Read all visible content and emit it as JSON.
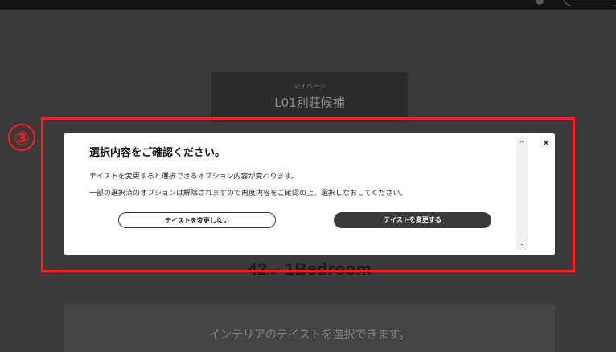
{
  "background": {
    "mypage_label": "マイページ",
    "plan_title": "L01別荘候補",
    "size_main": "42",
    "size_unit": "m²",
    "bedroom_label": "1Bedroom",
    "interior_prompt": "インテリアのテイストを選択できます。"
  },
  "annotation": {
    "step_number": "③",
    "color": "#ff1d1d"
  },
  "modal": {
    "title": "選択内容をご確認ください。",
    "message_line1": "テイストを変更すると選択できるオプション内容が変わります。",
    "message_line2": "一部の選択済のオプションは解除されますので再度内容をご確認の上、選択しなおしてください。",
    "keep_button": "テイストを変更しない",
    "change_button": "テイストを変更する",
    "close_glyph": "×",
    "scroll_up_glyph": "^",
    "scroll_down_glyph": "⌄"
  },
  "colors": {
    "overlay": "#3a3a3a",
    "modal_bg": "#ffffff",
    "primary_button": "#3a3a3a"
  }
}
